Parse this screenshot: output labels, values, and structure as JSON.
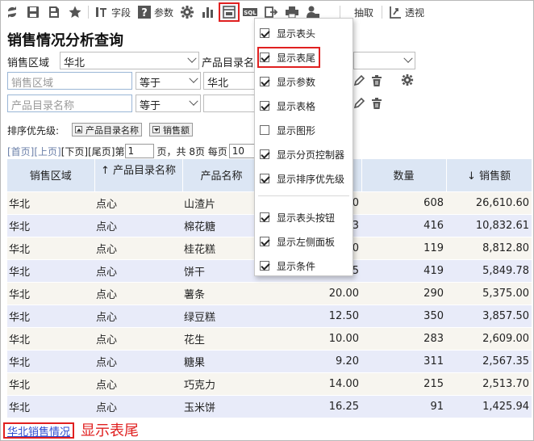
{
  "toolbar": {
    "items": [
      {
        "icon": "refresh-icon"
      },
      {
        "icon": "save-icon"
      },
      {
        "icon": "save-as-icon"
      },
      {
        "icon": "favorite-star-icon"
      },
      {
        "icon": "field-icon",
        "label": "字段"
      },
      {
        "icon": "parameter-icon",
        "label": "参数"
      },
      {
        "icon": "settings-gear-icon"
      },
      {
        "icon": "chart-icon"
      },
      {
        "icon": "table-options-icon"
      },
      {
        "icon": "sql-icon"
      },
      {
        "icon": "export-icon"
      },
      {
        "icon": "print-icon"
      },
      {
        "icon": "user-permission-icon"
      },
      {
        "label": "抽取"
      },
      {
        "icon": "pivot-icon",
        "label": "透视"
      }
    ]
  },
  "page_title": "销售情况分析查询",
  "filters": {
    "region_label": "销售区域",
    "region_value": "华北",
    "catalog_label": "产品目录名",
    "row1": {
      "field_placeholder": "销售区域",
      "operator": "等于",
      "value": "华北"
    },
    "row2": {
      "field_placeholder": "产品目录名称",
      "operator": "等于",
      "value": ""
    }
  },
  "sort": {
    "label": "排序优先级:",
    "buttons": [
      {
        "label": "产品目录名称",
        "direction": "asc"
      },
      {
        "label": "销售额",
        "direction": "desc"
      }
    ]
  },
  "pager": {
    "first": "[首页]",
    "prev": "[上页]",
    "next": "[下页]",
    "last": "[尾页]",
    "page_prefix": "第",
    "page_value": "1",
    "page_total": "页，共 8页 每页",
    "per_page": "10"
  },
  "table": {
    "headers": [
      "销售区域",
      "↑ 产品目录名称",
      "产品名称",
      "",
      "数量",
      "↓ 销售额"
    ],
    "rows": [
      [
        "华北",
        "点心",
        "山渣片",
        "0",
        "608",
        "26,610.60"
      ],
      [
        "华北",
        "点心",
        "棉花糖",
        "3",
        "416",
        "10,832.61"
      ],
      [
        "华北",
        "点心",
        "桂花糕",
        "0",
        "119",
        "8,812.80"
      ],
      [
        "华北",
        "点心",
        "饼干",
        "5",
        "419",
        "5,849.78"
      ],
      [
        "华北",
        "点心",
        "薯条",
        "20.00",
        "290",
        "5,375.00"
      ],
      [
        "华北",
        "点心",
        "绿豆糕",
        "12.50",
        "350",
        "3,857.50"
      ],
      [
        "华北",
        "点心",
        "花生",
        "10.00",
        "283",
        "2,609.00"
      ],
      [
        "华北",
        "点心",
        "糖果",
        "9.20",
        "311",
        "2,567.35"
      ],
      [
        "华北",
        "点心",
        "巧克力",
        "14.00",
        "215",
        "2,513.70"
      ],
      [
        "华北",
        "点心",
        "玉米饼",
        "16.25",
        "91",
        "1,425.94"
      ]
    ]
  },
  "footer": {
    "link": "华北销售情况",
    "annotation": "显示表尾"
  },
  "menu": {
    "items": [
      {
        "label": "显示表头",
        "checked": true
      },
      {
        "label": "显示表尾",
        "checked": true
      },
      {
        "label": "显示参数",
        "checked": true
      },
      {
        "label": "显示表格",
        "checked": true
      },
      {
        "label": "显示图形",
        "checked": false
      },
      {
        "label": "显示分页控制器",
        "checked": true
      },
      {
        "label": "显示排序优先级",
        "checked": true
      },
      {
        "label": "显示表头按钮",
        "checked": true
      },
      {
        "label": "显示左侧面板",
        "checked": true
      },
      {
        "label": "显示条件",
        "checked": true
      }
    ]
  },
  "colors": {
    "accent_red": "#e02020",
    "header_bg": "#dce6f4",
    "row_odd": "#f7f5ef",
    "row_even": "#e8ebf9",
    "link_blue": "#2c4bd0"
  }
}
